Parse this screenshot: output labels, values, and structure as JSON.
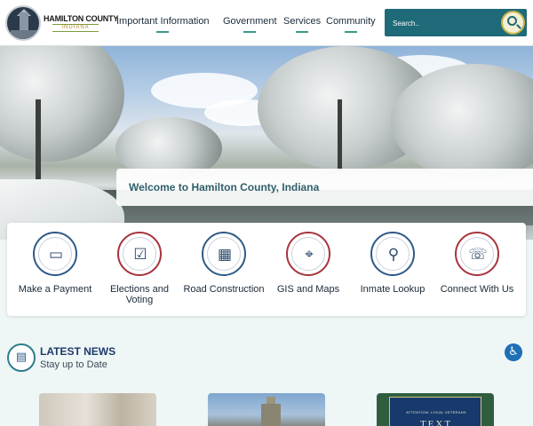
{
  "header": {
    "brand_name": "HAMILTON COUNTY",
    "brand_state": "INDIANA",
    "nav": [
      {
        "label": "Important Information"
      },
      {
        "label": "Government"
      },
      {
        "label": "Services"
      },
      {
        "label": "Community"
      }
    ],
    "search": {
      "placeholder": "Search.."
    }
  },
  "hero": {
    "welcome": "Welcome to Hamilton County, Indiana"
  },
  "quick_links": [
    {
      "label": "Make a Payment",
      "icon": "payment-card-icon"
    },
    {
      "label": "Elections and Voting",
      "icon": "ballot-icon"
    },
    {
      "label": "Road Construction",
      "icon": "road-barrier-icon"
    },
    {
      "label": "GIS and Maps",
      "icon": "map-pin-icon"
    },
    {
      "label": "Inmate Lookup",
      "icon": "magnifier-icon"
    },
    {
      "label": "Connect With Us",
      "icon": "phone-chat-icon"
    }
  ],
  "news": {
    "title": "LATEST NEWS",
    "subtitle": "Stay up to Date"
  },
  "news_cards": [
    {
      "image": "hand-photo"
    },
    {
      "image": "courthouse-photo"
    },
    {
      "image": "veterans-poster",
      "lines": [
        "ATTENTION: LOCAL VETERANS",
        "TEXT"
      ]
    }
  ],
  "colors": {
    "header_bg": "#ffffff",
    "search_bg": "#1f6a78",
    "accent_teal": "#3b9a8a",
    "ring_blue": "#2e5a86",
    "ring_red": "#a8333c",
    "page_bg": "#eef6f6"
  }
}
